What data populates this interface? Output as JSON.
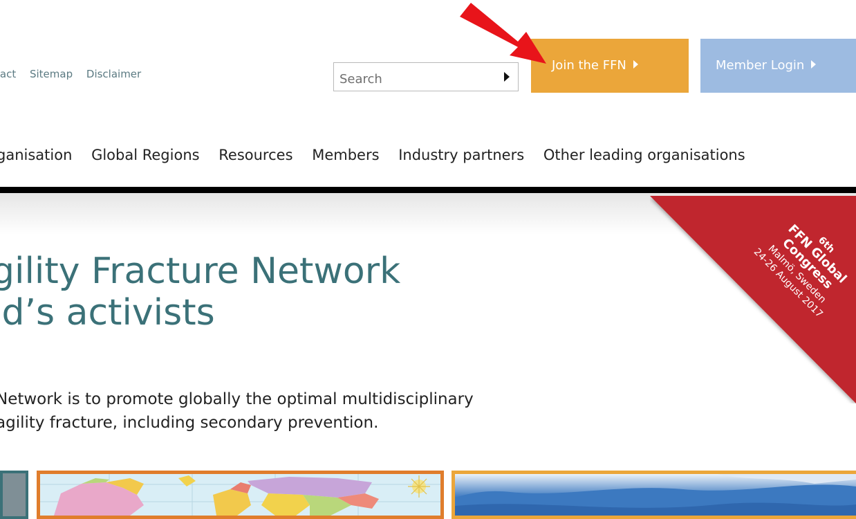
{
  "utility_links": [
    "tact",
    "Sitemap",
    "Disclaimer"
  ],
  "search": {
    "placeholder": "Search"
  },
  "buttons": {
    "join": "Join the FFN",
    "login": "Member Login"
  },
  "main_nav": [
    "ganisation",
    "Global Regions",
    "Resources",
    "Members",
    "Industry partners",
    "Other leading organisations"
  ],
  "hero": {
    "title_line1": "gility Fracture Network",
    "title_line2": "ld’s activists",
    "text_line1": "Network is to promote globally the optimal multidisciplinary",
    "text_line2": "agility fracture, including secondary prevention."
  },
  "ribbon": {
    "line1": "6th",
    "line2": "FFN Global",
    "line3": "Congress",
    "line4": "Malmö, Sweden",
    "line5": "24-26 August 2017"
  },
  "colors": {
    "join_button": "#eba63a",
    "login_button": "#9dbbe1",
    "heading": "#3b7178",
    "ribbon": "#c0272d",
    "annotation_arrow": "#e8141a"
  }
}
